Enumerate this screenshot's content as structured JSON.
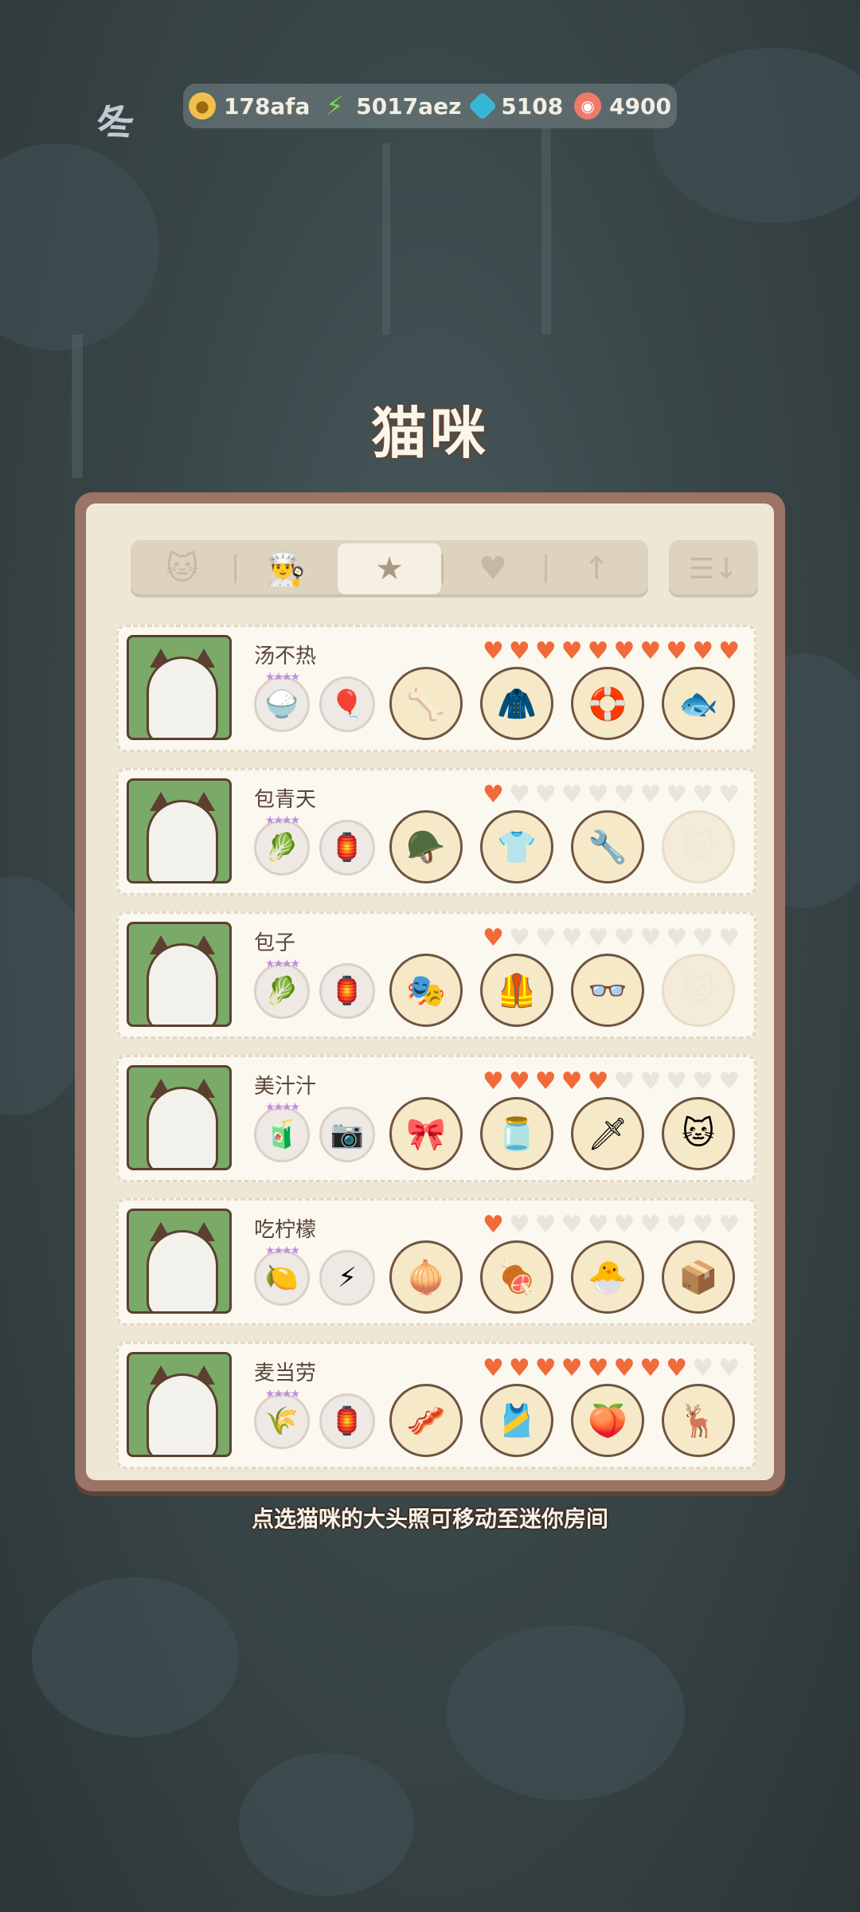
{
  "season": "冬",
  "resources": [
    {
      "icon": "coin-icon",
      "value": "178afa"
    },
    {
      "icon": "lightning-icon",
      "value": "5017aez"
    },
    {
      "icon": "gem-icon",
      "value": "5108"
    },
    {
      "icon": "shell-icon",
      "value": "4900"
    }
  ],
  "title": "猫咪",
  "tabs": [
    {
      "icon": "cat-icon",
      "glyph": "🐱",
      "active": false
    },
    {
      "icon": "chef-hat-icon",
      "glyph": "👨‍🍳",
      "active": false
    },
    {
      "icon": "star-icon",
      "glyph": "★",
      "active": true
    },
    {
      "icon": "heart-icon",
      "glyph": "♥",
      "active": false
    },
    {
      "icon": "arrow-up-icon",
      "glyph": "↑",
      "active": false
    }
  ],
  "sort_icon": "sort-icon",
  "cats": [
    {
      "name": "汤不热",
      "hearts": 10,
      "slot1": "🍚",
      "slot2": "🎈",
      "items": [
        "🦴",
        "🧥",
        "🛟",
        "🐟"
      ]
    },
    {
      "name": "包青天",
      "hearts": 1,
      "slot1": "🥬",
      "slot2": "🏮",
      "items": [
        "🪖",
        "👕",
        "🔧",
        ""
      ]
    },
    {
      "name": "包子",
      "hearts": 1,
      "slot1": "🥬",
      "slot2": "🏮",
      "items": [
        "🎭",
        "🦺",
        "👓",
        ""
      ]
    },
    {
      "name": "美汁汁",
      "hearts": 5,
      "slot1": "🧃",
      "slot2": "📷",
      "items": [
        "🎀",
        "🫙",
        "🗡",
        "🐱"
      ]
    },
    {
      "name": "吃柠檬",
      "hearts": 1,
      "slot1": "🍋",
      "slot2": "⚡",
      "items": [
        "🧅",
        "🍖",
        "🐣",
        "📦"
      ]
    },
    {
      "name": "麦当劳",
      "hearts": 8,
      "slot1": "🌾",
      "slot2": "🏮",
      "items": [
        "🥓",
        "🎽",
        "🍑",
        "🦌"
      ]
    }
  ],
  "hint": "点选猫咪的大头照可移动至迷你房间"
}
